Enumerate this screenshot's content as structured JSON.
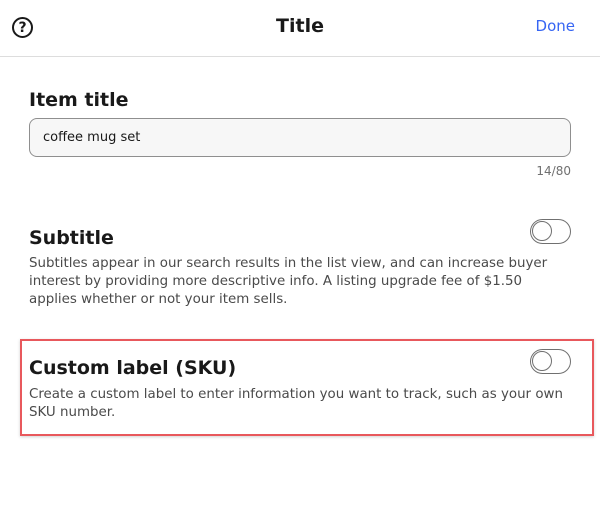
{
  "header": {
    "help_glyph": "?",
    "title": "Title",
    "done_label": "Done"
  },
  "item_title": {
    "heading": "Item title",
    "value": "coffee mug set",
    "char_count": "14/80"
  },
  "subtitle": {
    "heading": "Subtitle",
    "description": "Subtitles appear in our search results in the list view, and can increase buyer interest by providing more descriptive info. A listing upgrade fee of $1.50 applies whether or not your item sells.",
    "enabled": false
  },
  "custom_label": {
    "heading": "Custom label (SKU)",
    "description": "Create a custom label to enter information you want to track, such as your own SKU number.",
    "enabled": false
  },
  "colors": {
    "accent": "#3665f3",
    "highlight": "#e8585c"
  }
}
